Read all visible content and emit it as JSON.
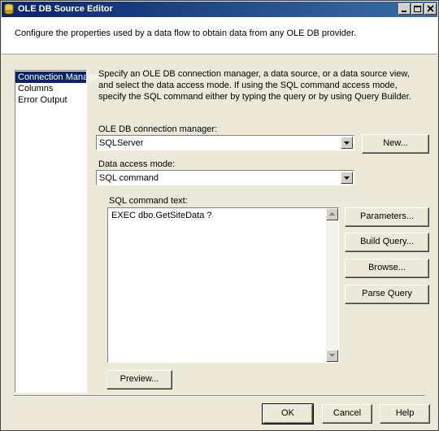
{
  "window": {
    "title": "OLE DB Source Editor"
  },
  "header": {
    "description": "Configure the properties used by a data flow to obtain data from any OLE DB provider."
  },
  "sidebar": {
    "items": [
      {
        "label": "Connection Manager",
        "selected": true
      },
      {
        "label": "Columns"
      },
      {
        "label": "Error Output"
      }
    ]
  },
  "main": {
    "description": "Specify an OLE DB connection manager, a data source, or a data source view, and select the data access mode. If using the SQL command access mode, specify the SQL command either by typing the query or by using Query Builder.",
    "connection_label": "OLE DB connection manager:",
    "connection_value": "SQLServer",
    "new_button": "New...",
    "access_mode_label": "Data access mode:",
    "access_mode_value": "SQL command",
    "sql_label": "SQL command text:",
    "sql_text": "EXEC dbo.GetSiteData ?",
    "parameters_button": "Parameters...",
    "build_query_button": "Build Query...",
    "browse_button": "Browse...",
    "parse_query_button": "Parse Query",
    "preview_button": "Preview..."
  },
  "footer": {
    "ok_button": "OK",
    "cancel_button": "Cancel",
    "help_button": "Help"
  }
}
